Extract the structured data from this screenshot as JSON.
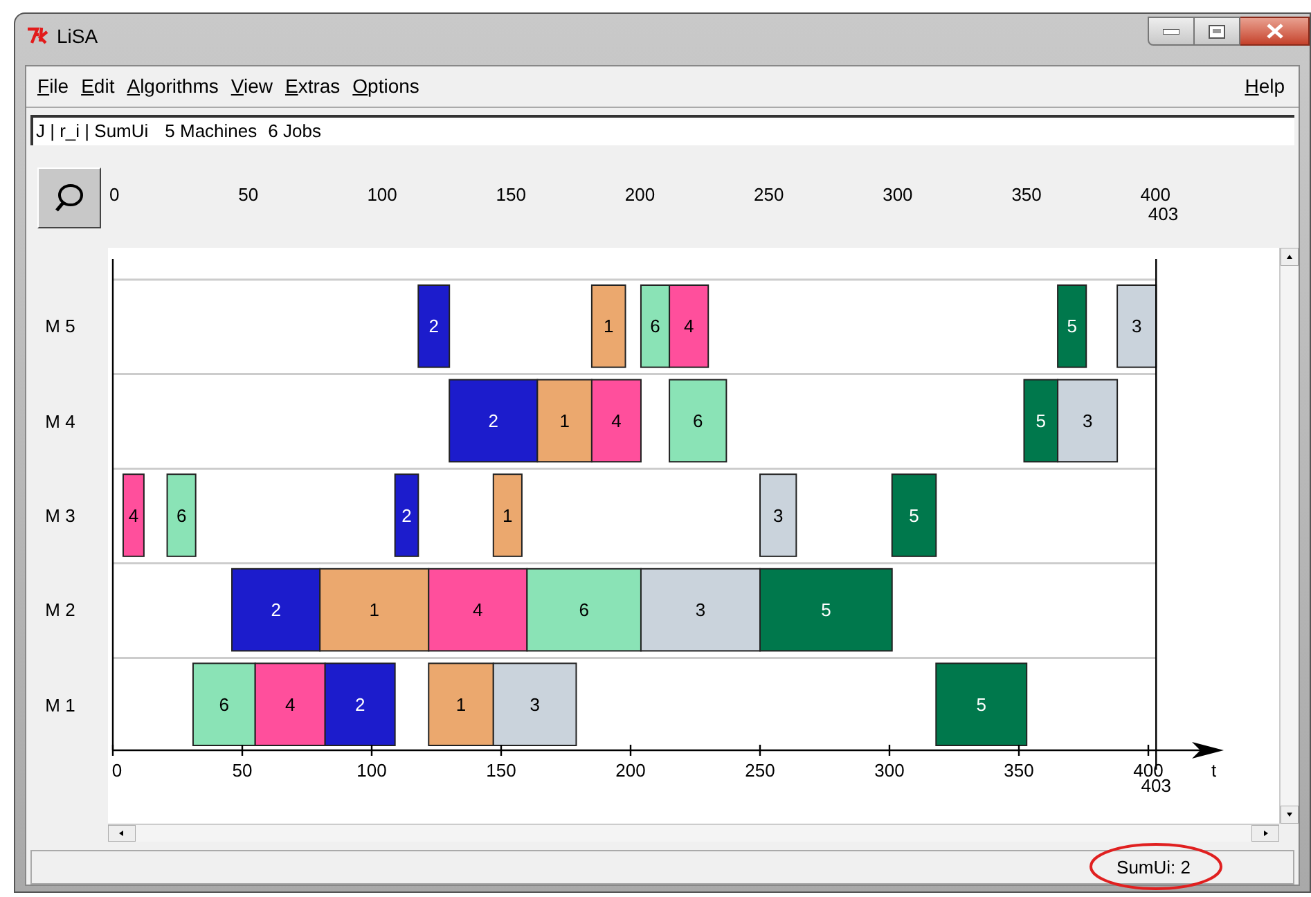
{
  "window": {
    "title": "LiSA"
  },
  "menu": [
    "File",
    "Edit",
    "Algorithms",
    "View",
    "Extras",
    "Options"
  ],
  "help_menu": "Help",
  "problem_field": {
    "value": "J | r_i | SumUi",
    "machines": "5 Machines",
    "jobs": "6 Jobs"
  },
  "top_ruler": {
    "ticks": [
      "0",
      "50",
      "100",
      "150",
      "200",
      "250",
      "300",
      "350",
      "400"
    ],
    "makespan": "403"
  },
  "gantt": {
    "axis_label": "t",
    "ticks": [
      "0",
      "50",
      "100",
      "150",
      "200",
      "250",
      "300",
      "350",
      "400"
    ],
    "makespan": "403",
    "machines": [
      {
        "label": "M 5",
        "operations": [
          {
            "job": "2",
            "color": "#1c1ccc"
          },
          {
            "job": "1",
            "color": "#eba86e"
          },
          {
            "job": "6",
            "color": "#8ae3b6"
          },
          {
            "job": "4",
            "color": "#ff4f9c"
          },
          {
            "job": "5",
            "color": "#00784c"
          },
          {
            "job": "3",
            "color": "#cad3dc"
          }
        ]
      },
      {
        "label": "M 4",
        "operations": [
          {
            "job": "2",
            "color": "#1c1ccc"
          },
          {
            "job": "1",
            "color": "#eba86e"
          },
          {
            "job": "4",
            "color": "#ff4f9c"
          },
          {
            "job": "6",
            "color": "#8ae3b6"
          },
          {
            "job": "5",
            "color": "#00784c"
          },
          {
            "job": "3",
            "color": "#cad3dc"
          }
        ]
      },
      {
        "label": "M 3",
        "operations": [
          {
            "job": "4",
            "color": "#ff4f9c"
          },
          {
            "job": "6",
            "color": "#8ae3b6"
          },
          {
            "job": "2",
            "color": "#1c1ccc"
          },
          {
            "job": "1",
            "color": "#eba86e"
          },
          {
            "job": "3",
            "color": "#cad3dc"
          },
          {
            "job": "5",
            "color": "#00784c"
          }
        ]
      },
      {
        "label": "M 2",
        "operations": [
          {
            "job": "2",
            "color": "#1c1ccc"
          },
          {
            "job": "1",
            "color": "#eba86e"
          },
          {
            "job": "4",
            "color": "#ff4f9c"
          },
          {
            "job": "6",
            "color": "#8ae3b6"
          },
          {
            "job": "3",
            "color": "#cad3dc"
          },
          {
            "job": "5",
            "color": "#00784c"
          }
        ]
      },
      {
        "label": "M 1",
        "operations": [
          {
            "job": "6",
            "color": "#8ae3b6"
          },
          {
            "job": "4",
            "color": "#ff4f9c"
          },
          {
            "job": "2",
            "color": "#1c1ccc"
          },
          {
            "job": "1",
            "color": "#eba86e"
          },
          {
            "job": "3",
            "color": "#cad3dc"
          },
          {
            "job": "5",
            "color": "#00784c"
          }
        ]
      }
    ]
  },
  "status_bar": {
    "text": "SumUi: 2",
    "circled": true
  }
}
